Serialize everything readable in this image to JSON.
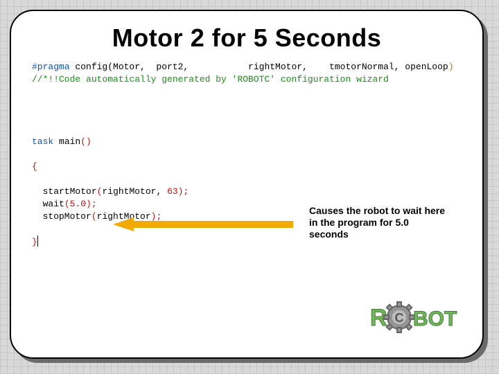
{
  "title": "Motor 2 for 5 Seconds",
  "code": {
    "pragma_kw": "#pragma",
    "pragma_rest": " config(Motor,  port2,           rightMotor,    tmotorNormal, openLoop",
    "pragma_close": ")",
    "gen_comment": "//*!!Code automatically generated by 'ROBOTC' configuration wizard",
    "task_kw": "task",
    "task_name": " main",
    "task_parens": "()",
    "open_brace": "{",
    "line1a": "  startMotor",
    "line1b": "(",
    "line1c": "rightMotor, ",
    "line1d": "63",
    "line1e": ");",
    "line2a": "  wait",
    "line2b": "(",
    "line2c": "5.0",
    "line2d": ");",
    "line3a": "  stopMotor",
    "line3b": "(",
    "line3c": "rightMotor",
    "line3d": ");",
    "close_brace": "}"
  },
  "callout": "Causes the robot to wait here in the program for 5.0 seconds",
  "logo": {
    "left_text": "R",
    "right_text": "BOT",
    "gear_label": "C"
  }
}
